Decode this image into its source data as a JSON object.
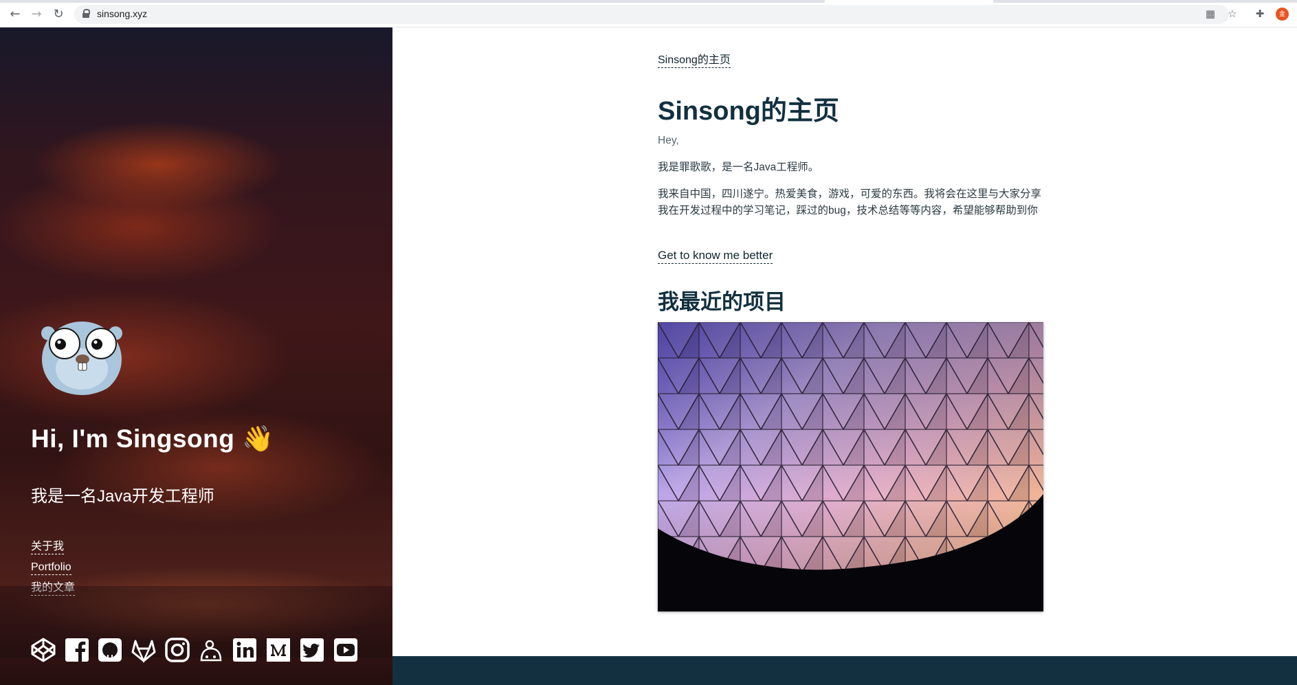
{
  "browser": {
    "url": "sinsong.xyz",
    "profile_initial": "金"
  },
  "hero": {
    "title": "Hi, I'm Singsong 👋",
    "subtitle": "我是一名Java开发工程师",
    "links": [
      "关于我",
      "Portfolio",
      "我的文章"
    ],
    "social_icons": [
      "codepen-icon",
      "facebook-icon",
      "github-icon",
      "gitlab-icon",
      "instagram-icon",
      "keybase-icon",
      "linkedin-icon",
      "medium-icon",
      "twitter-icon",
      "youtube-icon"
    ]
  },
  "main": {
    "breadcrumb": "Sinsong的主页",
    "title": "Sinsong的主页",
    "greeting": "Hey,",
    "intro1": "我是罪歌歌，是一名Java工程师。",
    "intro2": "我来自中国，四川遂宁。热爱美食，游戏，可爱的东西。我将会在这里与大家分享我在开发过程中的学习笔记，踩过的bug，技术总结等等内容，希望能够帮助到你",
    "more_link": "Get to know me better",
    "projects_heading": "我最近的项目"
  },
  "colors": {
    "heading": "#12303f",
    "footer": "#12303f",
    "text": "#2b3a42"
  }
}
